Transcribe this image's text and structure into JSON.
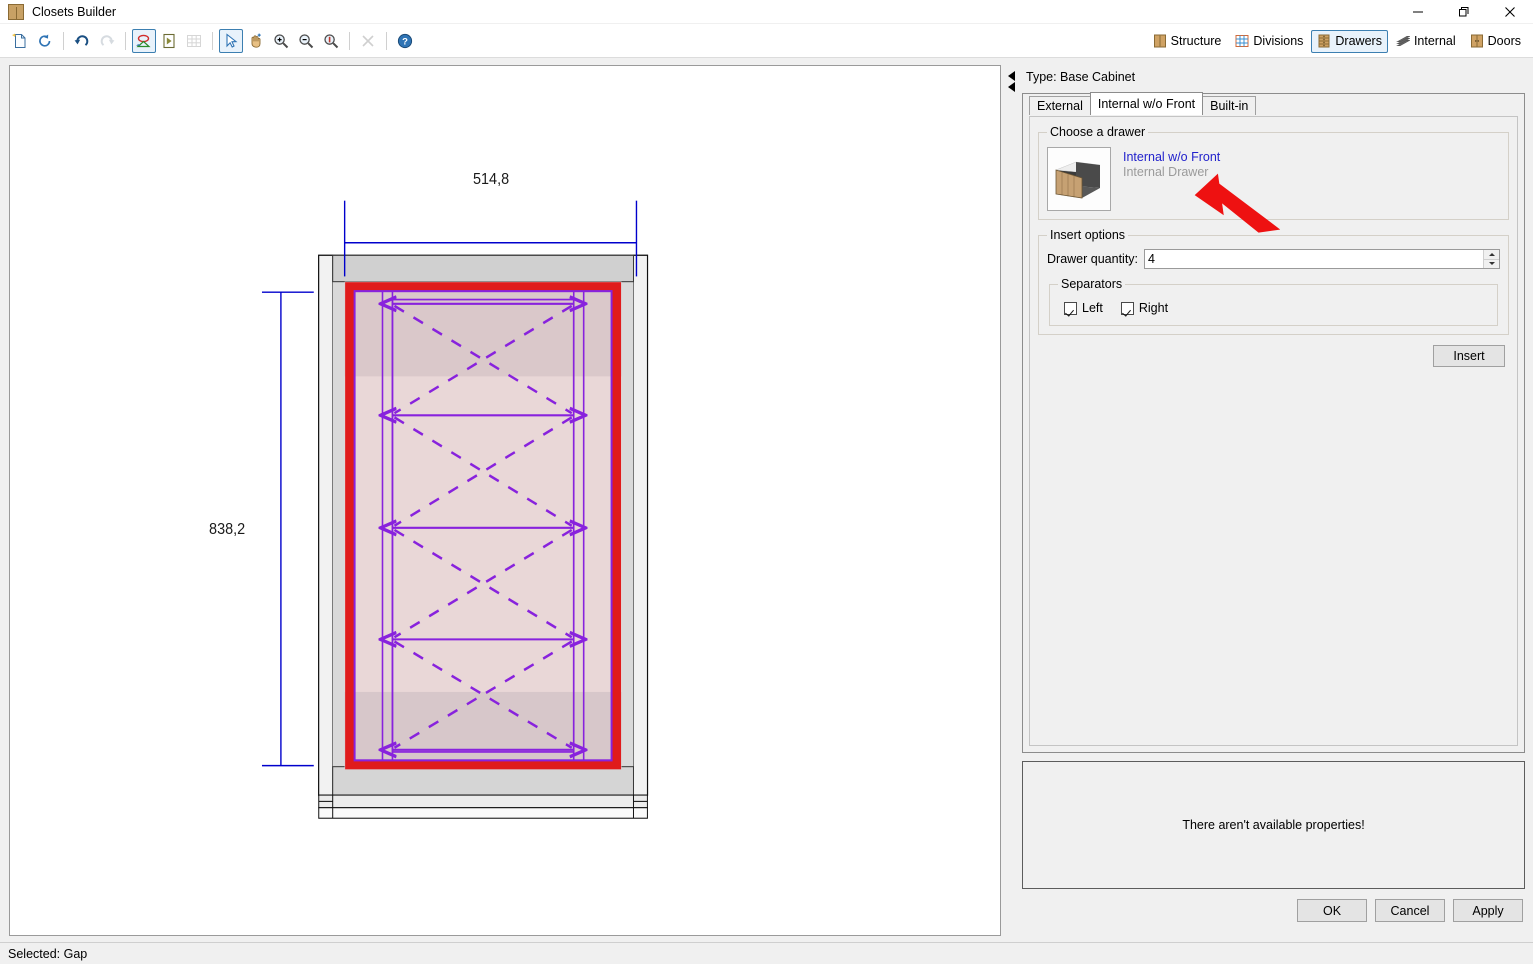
{
  "window": {
    "title": "Closets Builder",
    "icon": "cabinet-icon",
    "minimize": "—",
    "maximize": "❐",
    "close": "✕"
  },
  "toolbar": {
    "groups": [
      [
        {
          "name": "new-document-button",
          "icon": "new-document-icon",
          "tooltip": "New",
          "selected": false,
          "disabled": false
        }
      ],
      [
        {
          "name": "reload-button",
          "icon": "refresh-icon",
          "tooltip": "Reload",
          "selected": false,
          "disabled": false
        }
      ],
      [
        {
          "name": "undo-button",
          "icon": "undo-icon",
          "tooltip": "Undo",
          "selected": false,
          "disabled": false
        },
        {
          "name": "redo-button",
          "icon": "redo-icon",
          "tooltip": "Redo",
          "selected": false,
          "disabled": true
        }
      ],
      [
        {
          "name": "edit-shape-button",
          "icon": "edit-shape-icon",
          "tooltip": "Edit shape",
          "selected": true,
          "disabled": false
        },
        {
          "name": "play-button",
          "icon": "play-outline-icon",
          "tooltip": "Run",
          "selected": false,
          "disabled": false
        },
        {
          "name": "grid-button",
          "icon": "grid-icon",
          "tooltip": "Grid",
          "selected": false,
          "disabled": true
        }
      ],
      [
        {
          "name": "select-tool-button",
          "icon": "cursor-arrow-icon",
          "tooltip": "Select",
          "selected": true,
          "disabled": false
        },
        {
          "name": "pan-tool-button",
          "icon": "hand-pan-icon",
          "tooltip": "Pan",
          "selected": false,
          "disabled": false
        },
        {
          "name": "zoom-in-button",
          "icon": "magnifier-plus-icon",
          "tooltip": "Zoom in",
          "selected": false,
          "disabled": false
        },
        {
          "name": "zoom-out-button",
          "icon": "magnifier-minus-icon",
          "tooltip": "Zoom out",
          "selected": false,
          "disabled": false
        },
        {
          "name": "zoom-fit-button",
          "icon": "magnifier-one-icon",
          "tooltip": "Zoom 1:1",
          "selected": false,
          "disabled": false
        }
      ],
      [
        {
          "name": "delete-button",
          "icon": "close-x-icon",
          "tooltip": "Delete",
          "selected": false,
          "disabled": true
        }
      ],
      [
        {
          "name": "help-button",
          "icon": "help-question-icon",
          "tooltip": "Help",
          "selected": false,
          "disabled": false
        }
      ]
    ],
    "modules": [
      {
        "name": "module-structure",
        "label": "Structure",
        "icon": "cabinet-icon",
        "selected": false
      },
      {
        "name": "module-divisions",
        "label": "Divisions",
        "icon": "grid-blue-icon",
        "selected": false
      },
      {
        "name": "module-drawers",
        "label": "Drawers",
        "icon": "drawers-icon",
        "selected": true
      },
      {
        "name": "module-internal",
        "label": "Internal",
        "icon": "shelves-icon",
        "selected": false
      },
      {
        "name": "module-doors",
        "label": "Doors",
        "icon": "doors-icon",
        "selected": false
      }
    ]
  },
  "canvas": {
    "type_label": "Type: Base Cabinet",
    "dimensions": {
      "width_value": "514,8",
      "height_value": "838,2"
    },
    "drawing": {
      "description": "front elevation of base cabinet with 4 internal drawers shown as crossed dashed boxes",
      "drawer_count": 4,
      "selection_color": "#e01b1b",
      "drawer_outline_color": "#8822dd",
      "dimension_color": "#0000cc",
      "carcass_color": "#c9c9c9",
      "interior_fill": "#e9d4d4"
    }
  },
  "panel": {
    "collapse_icon": "collapse-left-icon",
    "type_label": "Type: Base Cabinet",
    "tabs": [
      {
        "name": "tab-external",
        "label": "External",
        "active": false
      },
      {
        "name": "tab-internal-wo-front",
        "label": "Internal w/o Front",
        "active": true
      },
      {
        "name": "tab-built-in",
        "label": "Built-in",
        "active": false
      }
    ],
    "choose_drawer": {
      "legend": "Choose a drawer",
      "thumbnail_name": "drawer-3d-thumbnail",
      "title": "Internal w/o Front",
      "subtitle": "Internal Drawer",
      "title_color": "#2222cc",
      "subtitle_color": "#9a9a9a"
    },
    "insert_options": {
      "legend": "Insert options",
      "quantity_label": "Drawer quantity:",
      "quantity_value": "4",
      "quantity_placeholder": "",
      "separators": {
        "legend": "Separators",
        "left": {
          "label": "Left",
          "checked": true
        },
        "right": {
          "label": "Right",
          "checked": true
        }
      }
    },
    "insert_button": "Insert",
    "properties_message": "There aren't available properties!",
    "dialog_buttons": [
      {
        "name": "ok-button",
        "label": "OK"
      },
      {
        "name": "cancel-button",
        "label": "Cancel"
      },
      {
        "name": "apply-button",
        "label": "Apply"
      }
    ]
  },
  "statusbar": {
    "text": "Selected: Gap"
  }
}
